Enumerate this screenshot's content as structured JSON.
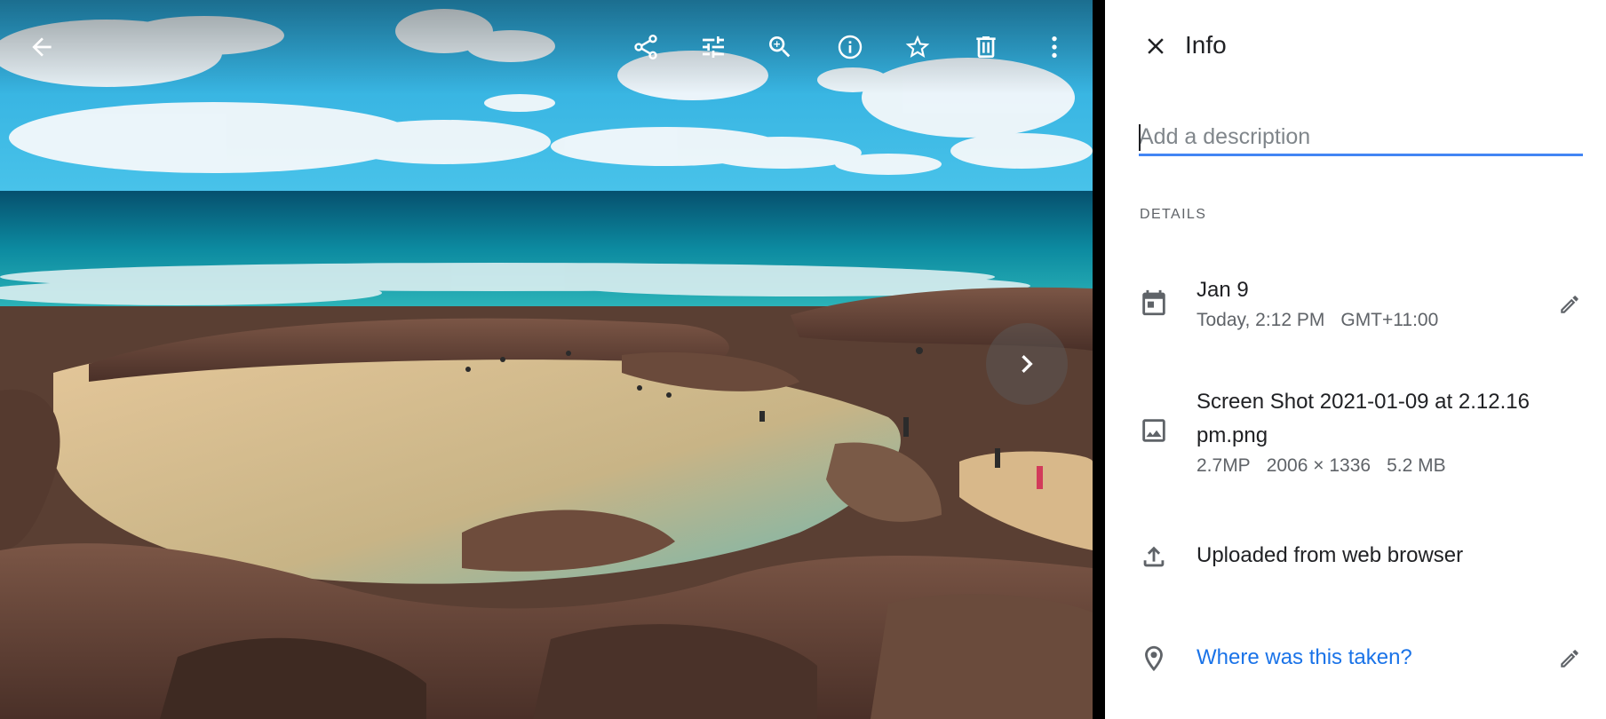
{
  "viewer": {
    "photo": "beach rock pools with ocean and clouds",
    "toolbar": [
      {
        "name": "share-icon"
      },
      {
        "name": "edit-adjust-icon"
      },
      {
        "name": "zoom-in-icon"
      },
      {
        "name": "info-icon"
      },
      {
        "name": "favorite-star-icon"
      },
      {
        "name": "delete-trash-icon"
      },
      {
        "name": "more-options-icon"
      }
    ],
    "back_icon": "arrow-back-icon",
    "next_icon": "chevron-right-icon"
  },
  "panel": {
    "title": "Info",
    "close_icon": "close-icon",
    "description": {
      "placeholder": "Add a description",
      "value": ""
    },
    "section_label": "DETAILS",
    "date": {
      "icon": "calendar-icon",
      "primary": "Jan 9",
      "time": "Today, 2:12 PM",
      "timezone": "GMT+11:00"
    },
    "file": {
      "icon": "image-icon",
      "name": "Screen Shot 2021-01-09 at 2.12.16 pm.png",
      "megapixels": "2.7MP",
      "dimensions": "2006 × 1336",
      "size": "5.2 MB"
    },
    "upload": {
      "icon": "upload-icon",
      "text": "Uploaded from web browser"
    },
    "location": {
      "icon": "location-pin-icon",
      "text": "Where was this taken?"
    }
  },
  "colors": {
    "accent": "#4285f4",
    "link": "#1a73e8",
    "text_primary": "#202124",
    "text_secondary": "#5f6368"
  }
}
